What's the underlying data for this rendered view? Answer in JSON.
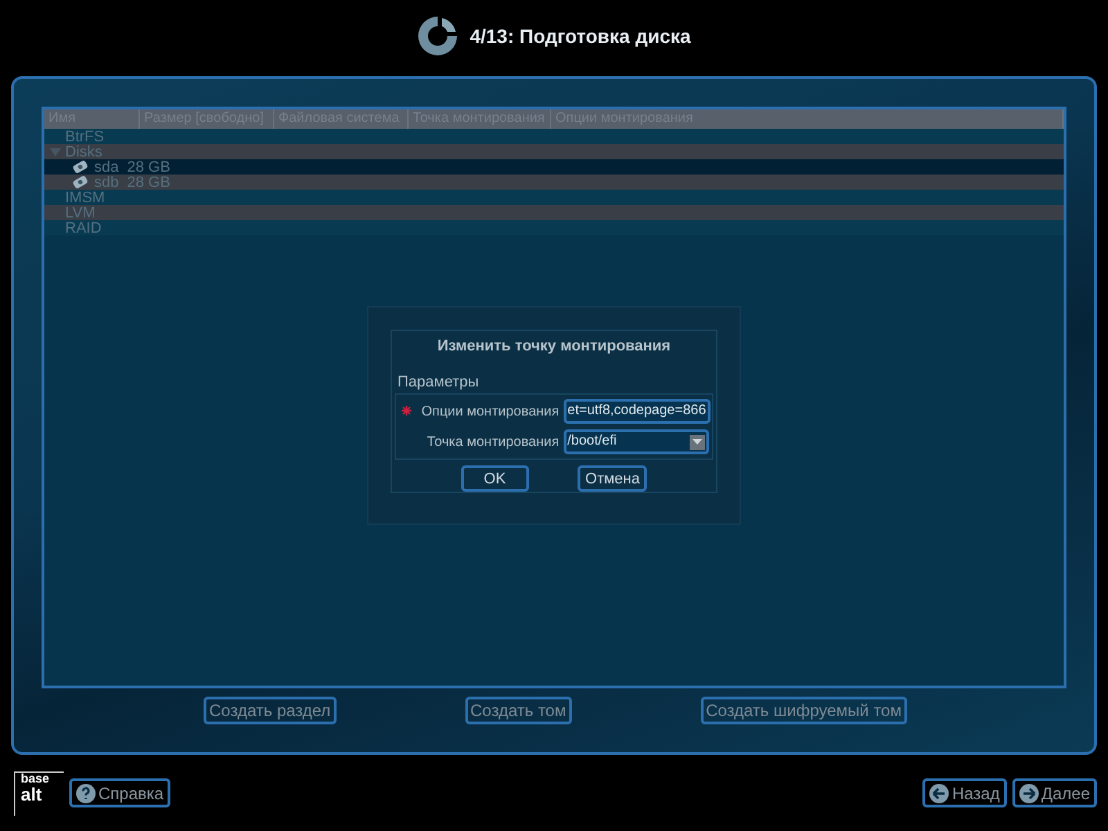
{
  "header": {
    "title": "4/13: Подготовка диска"
  },
  "table": {
    "columns": [
      "Имя",
      "Размер [свободно]",
      "Файловая система",
      "Точка монтирования",
      "Опции монтирования"
    ],
    "rows": [
      {
        "name": "BtrFS",
        "selected": false
      },
      {
        "name": "Disks",
        "expanded": true,
        "selected": false,
        "children": [
          {
            "name": "sda",
            "size": "28 GB",
            "selected": true
          },
          {
            "name": "sdb",
            "size": "28 GB",
            "selected": false
          }
        ]
      },
      {
        "name": "IMSM",
        "selected": false
      },
      {
        "name": "LVM",
        "selected": false
      },
      {
        "name": "RAID",
        "selected": false
      }
    ]
  },
  "actions": [
    "Создать раздел",
    "Создать том",
    "Создать шифруемый том"
  ],
  "dialog": {
    "title": "Изменить точку монтирования",
    "group": "Параметры",
    "fields": [
      {
        "kind": "text",
        "label": "Опции монтирования",
        "value": "et=utf8,codepage=866",
        "required": true
      },
      {
        "kind": "combo",
        "label": "Точка монтирования",
        "value": "/boot/efi",
        "required": false
      }
    ],
    "buttons": [
      "OK",
      "Отмена"
    ]
  },
  "footer": {
    "logo": [
      "base",
      "alt"
    ],
    "help": "Справка",
    "back": "Назад",
    "next": "Далее"
  }
}
